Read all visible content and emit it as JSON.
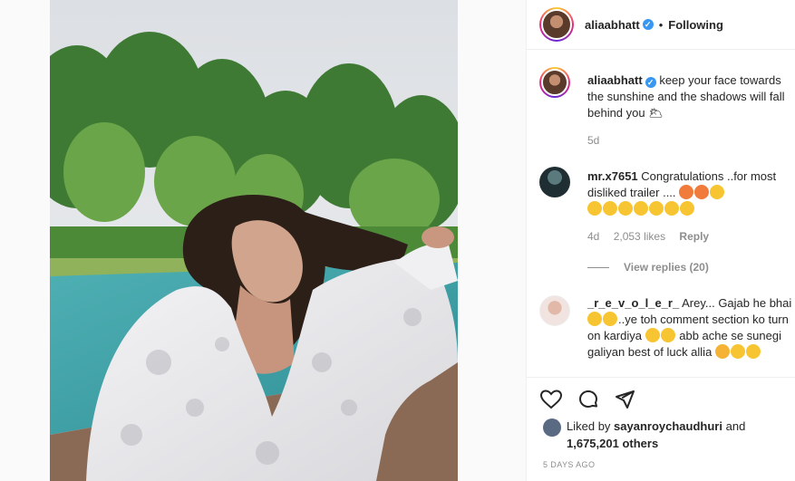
{
  "post": {
    "author": "aliaabhatt",
    "follow_status": "Following",
    "dot": "•",
    "caption": "keep your face towards the sunshine and the shadows will fall behind you 🌥",
    "caption_age": "5d",
    "likes_prefix": "Liked by",
    "liked_by_user": "sayanroychaudhuri",
    "likes_joiner": "and",
    "likes_count": "1,675,201 others",
    "timestamp": "5 DAYS AGO"
  },
  "comments": [
    {
      "user": "mr.x7651",
      "text": "Congratulations ..for most disliked trailer ....",
      "age": "4d",
      "likes": "2,053 likes",
      "reply_label": "Reply",
      "view_replies": "View replies (20)"
    },
    {
      "user": "_r_e_v_o_l_e_r_",
      "text_1": "Arey... Gajab he bhai",
      "text_2": "..ye toh comment section ko turn on kardiya",
      "text_3": "abb ache se sunegi galiyan best of luck allia"
    }
  ],
  "icons": {
    "like": "heart-icon",
    "comment": "comment-icon",
    "share": "share-icon",
    "verified": "verified-badge-icon"
  },
  "colors": {
    "accent": "#3897f0",
    "muted": "#8e8e8e",
    "text": "#262626"
  }
}
